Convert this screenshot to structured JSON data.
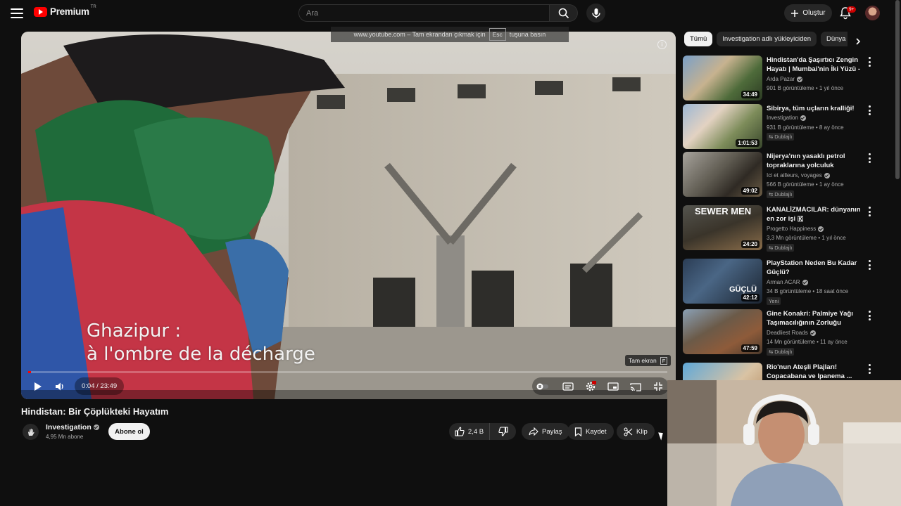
{
  "header": {
    "logo_text": "Premium",
    "logo_region": "TR",
    "search_placeholder": "Ara",
    "create_label": "Oluştur",
    "notification_badge": "9+"
  },
  "player": {
    "fullscreen_hint_prefix": "www.youtube.com – Tam ekrandan çıkmak için",
    "fullscreen_hint_key": "Esc",
    "fullscreen_hint_suffix": "tuşuna basın",
    "subtitle_line1": "Ghazipur :",
    "subtitle_line2": "à l'ombre de la décharge",
    "tooltip_label": "Tam ekran",
    "tooltip_key": "F",
    "time": "0:04 / 23:49",
    "progress_fraction": 0.0028
  },
  "video": {
    "title": "Hindistan: Bir Çöplükteki Hayatım",
    "channel": "Investigation",
    "subscribers": "4,95 Mn abone",
    "subscribe_label": "Abone ol",
    "likes": "2,4 B",
    "share_label": "Paylaş",
    "save_label": "Kaydet",
    "clip_label": "Klip"
  },
  "sidebar": {
    "chips": [
      "Tümü",
      "Investigation adlı yükleyiciden",
      "Dünya h"
    ],
    "recommendations": [
      {
        "title": "Hindistan'da Şaşırtıcı Zengin Hayatı | Mumbai'nin İki Yüzü - ...",
        "channel": "Arda Pazar",
        "meta": "901 B görüntüleme • 1 yıl önce",
        "duration": "34:49",
        "badge": ""
      },
      {
        "title": "Sibirya, tüm uçların kralliği!",
        "channel": "Investigation",
        "meta": "931 B görüntüleme • 8 ay önce",
        "duration": "1:01:53",
        "badge": "Dublajlı"
      },
      {
        "title": "Nijerya'nın yasaklı petrol topraklarına yolculuk",
        "channel": "Ici et ailleurs, voyages",
        "meta": "566 B görüntüleme • 1 ay önce",
        "duration": "49:02",
        "badge": "Dublajlı"
      },
      {
        "title": "KANALİZMACILAR: dünyanın en zor işi 🇰",
        "channel": "Progetto Happiness",
        "meta": "3,3 Mn görüntüleme • 1 yıl önce",
        "duration": "24:20",
        "badge": "Dublajlı",
        "thumb_text": "SEWER MEN"
      },
      {
        "title": "PlayStation Neden Bu Kadar Güçlü?",
        "channel": "Arman ACAR",
        "meta": "34 B görüntüleme • 18 saat önce",
        "duration": "42:12",
        "badge": "Yeni",
        "thumb_text": "GÜÇLÜ"
      },
      {
        "title": "Gine Konakri: Palmiye Yağı Taşımacılığının Zorluğu",
        "channel": "Deadliest Roads",
        "meta": "14 Mn görüntüleme • 11 ay önce",
        "duration": "47:59",
        "badge": "Dublajlı"
      },
      {
        "title": "Rio'nun Ateşli Plajları! Copacabana ve Ipanema ...",
        "channel": "",
        "meta": "",
        "duration": "",
        "badge": ""
      }
    ]
  },
  "colors": {
    "background": "#0f0f0f",
    "accent_red": "#ff0000",
    "chip_bg": "#272727"
  }
}
